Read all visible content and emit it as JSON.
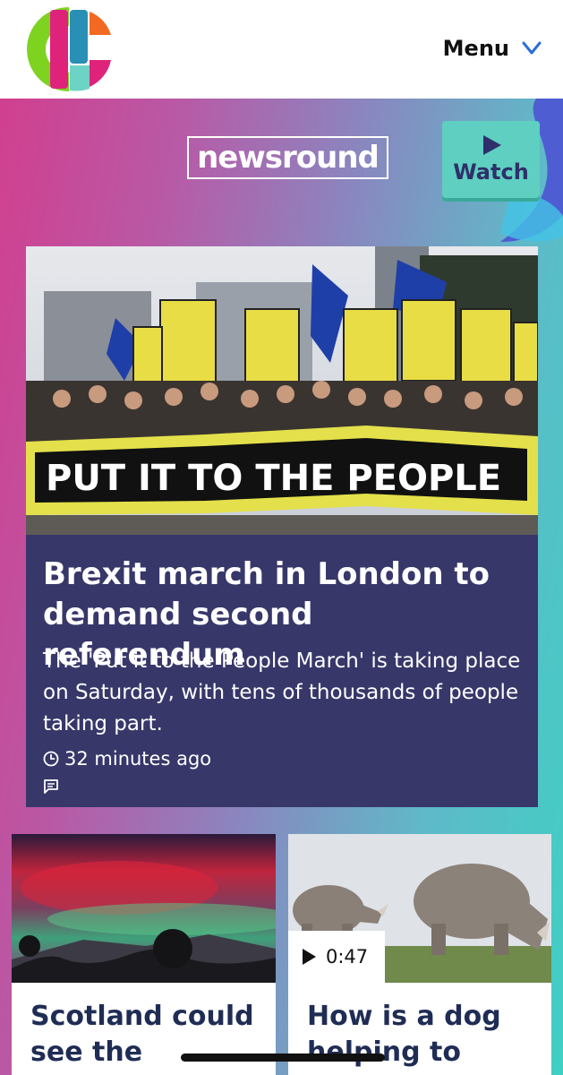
{
  "header": {
    "menu_label": "Menu",
    "logo_icon": "cbbc-logo-icon",
    "menu_icon": "chevron-down-icon"
  },
  "brand": {
    "name": "newsround",
    "watch_label": "Watch",
    "watch_icon": "play-icon"
  },
  "main_story": {
    "image_alt": "Protesters with PUT IT TO THE PEOPLE banner",
    "image_banner_text": "PUT IT TO THE PEOPLE",
    "title": "Brexit march in London to demand second referendum",
    "summary": "The 'Put it to the People March' is taking place on Saturday, with tens of thousands of people taking part.",
    "time": "32 minutes ago",
    "time_icon": "clock-icon",
    "comment_icon": "comment-icon"
  },
  "stories": [
    {
      "title": "Scotland could see the",
      "image": "aurora-sky"
    },
    {
      "title": "How is a dog helping to save",
      "image": "rhinos",
      "duration": "0:47",
      "duration_icon": "play-icon"
    }
  ],
  "colors": {
    "card_bg": "#37376a",
    "watch_bg": "#5ecfc0",
    "title_dark": "#1f2d55"
  }
}
